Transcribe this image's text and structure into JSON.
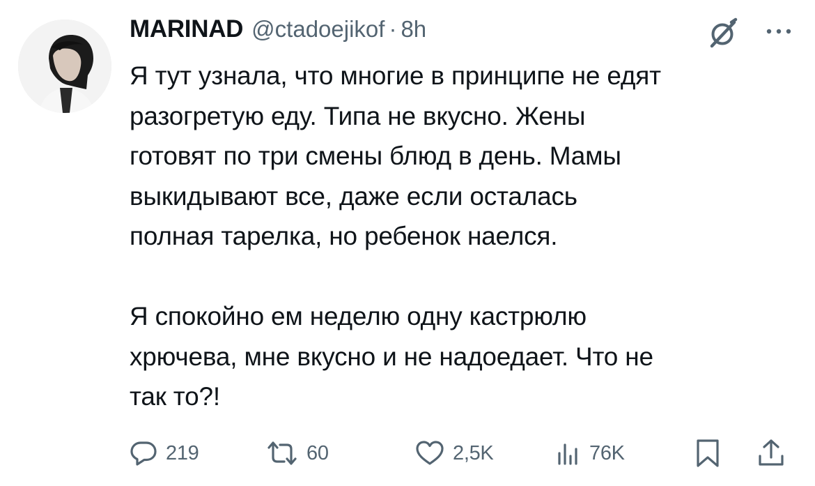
{
  "author": {
    "display_name": "MARINAD",
    "handle": "@ctadoejikof",
    "separator": "·",
    "time": "8h"
  },
  "tweet": {
    "paragraphs": [
      "Я тут узнала, что многие в принципе не едят\nразогретую еду. Типа не вкусно. Жены\nготовят по три смены блюд в день. Мамы\nвыкидывают все, даже если осталась\nполная тарелка, но ребенок наелся.",
      "Я спокойно ем неделю одну кастрюлю\nхрючева, мне вкусно и не надоедает. Что не\nтак то?!"
    ]
  },
  "actions": {
    "replies": "219",
    "reposts": "60",
    "likes": "2,5K",
    "views": "76K"
  },
  "icons": {
    "header": [
      "grok-icon",
      "more-icon"
    ],
    "actions": [
      "reply-icon",
      "repost-icon",
      "like-icon",
      "views-icon",
      "bookmark-icon",
      "share-icon"
    ]
  },
  "colors": {
    "text": "#0f1419",
    "secondary": "#536471",
    "background": "#ffffff"
  }
}
